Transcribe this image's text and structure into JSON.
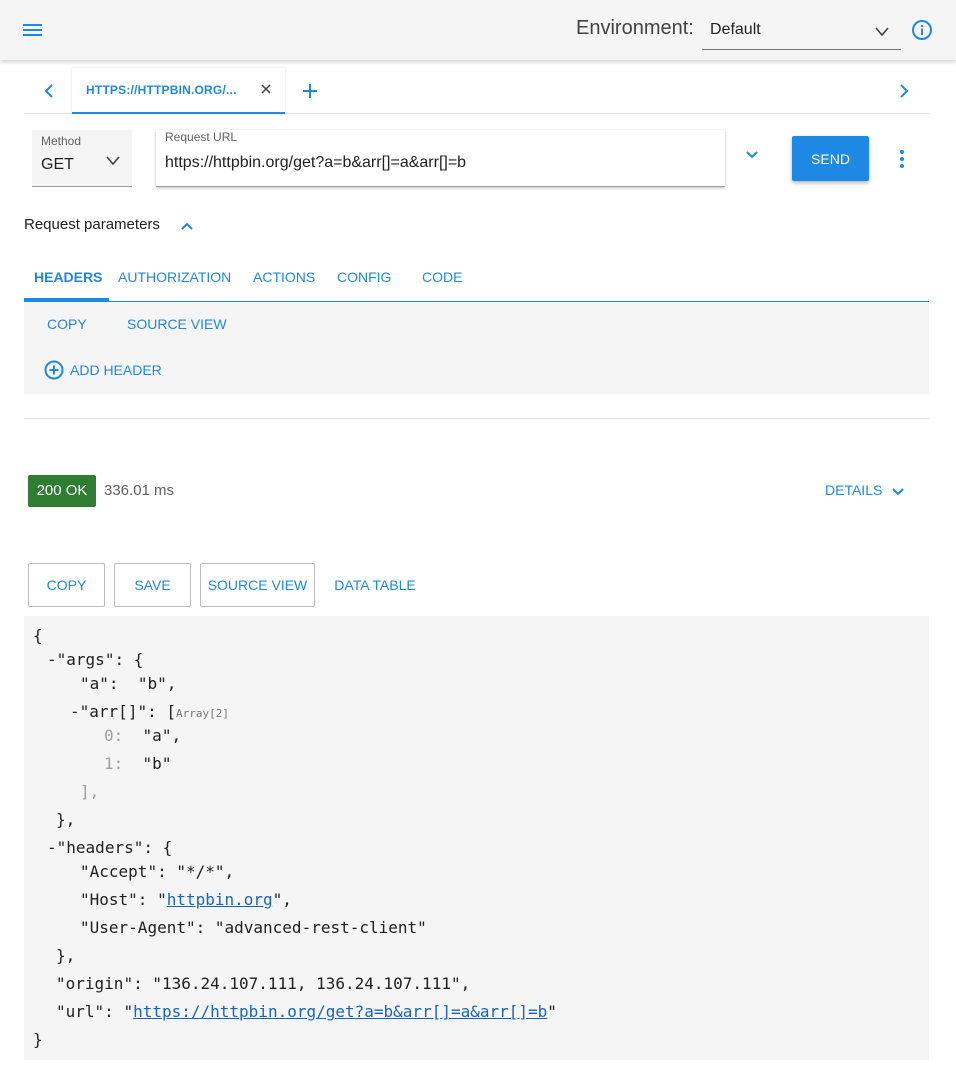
{
  "topbar": {
    "menu_icon": "menu-icon",
    "env_label": "Environment:",
    "env_value": "Default",
    "info_icon": "info-icon"
  },
  "tabs": {
    "items": [
      {
        "label": "HTTPS://HTTPBIN.ORG/..."
      }
    ],
    "prev_icon": "chevron-left-icon",
    "next_icon": "chevron-right-icon",
    "add_icon": "plus-icon",
    "close_icon": "close-icon"
  },
  "request": {
    "method_label": "Method",
    "method_value": "GET",
    "url_label": "Request URL",
    "url_value": "https://httpbin.org/get?a=b&arr[]=a&arr[]=b",
    "send_label": "SEND"
  },
  "params": {
    "toggle_label": "Request parameters",
    "tabs": [
      "HEADERS",
      "AUTHORIZATION",
      "ACTIONS",
      "CONFIG",
      "CODE"
    ],
    "copy_label": "COPY",
    "source_view_label": "SOURCE VIEW",
    "add_header_label": "ADD HEADER"
  },
  "response": {
    "status": "200 OK",
    "time": "336.01 ms",
    "details_label": "DETAILS",
    "buttons": {
      "copy": "COPY",
      "save": "SAVE",
      "source_view": "SOURCE VIEW",
      "data_table": "DATA TABLE"
    },
    "json": {
      "args_key": "args",
      "a_key": "a",
      "a_value": "b",
      "arr_key": "arr[]",
      "arr_badge": "Array[2]",
      "arr_0_index": "0:",
      "arr_0_value": "a",
      "arr_1_index": "1:",
      "arr_1_value": "b",
      "headers_key": "headers",
      "accept_key": "Accept",
      "accept_value": "*/*",
      "host_key": "Host",
      "host_value": "httpbin.org",
      "ua_key": "User-Agent",
      "ua_value": "advanced-rest-client",
      "origin_key": "origin",
      "origin_value": "136.24.107.111, 136.24.107.111",
      "url_key": "url",
      "url_value": "https://httpbin.org/get?a=b&arr[]=a&arr[]=b"
    }
  },
  "colors": {
    "accent": "#1e88e5",
    "status_ok": "#2e7d32"
  }
}
